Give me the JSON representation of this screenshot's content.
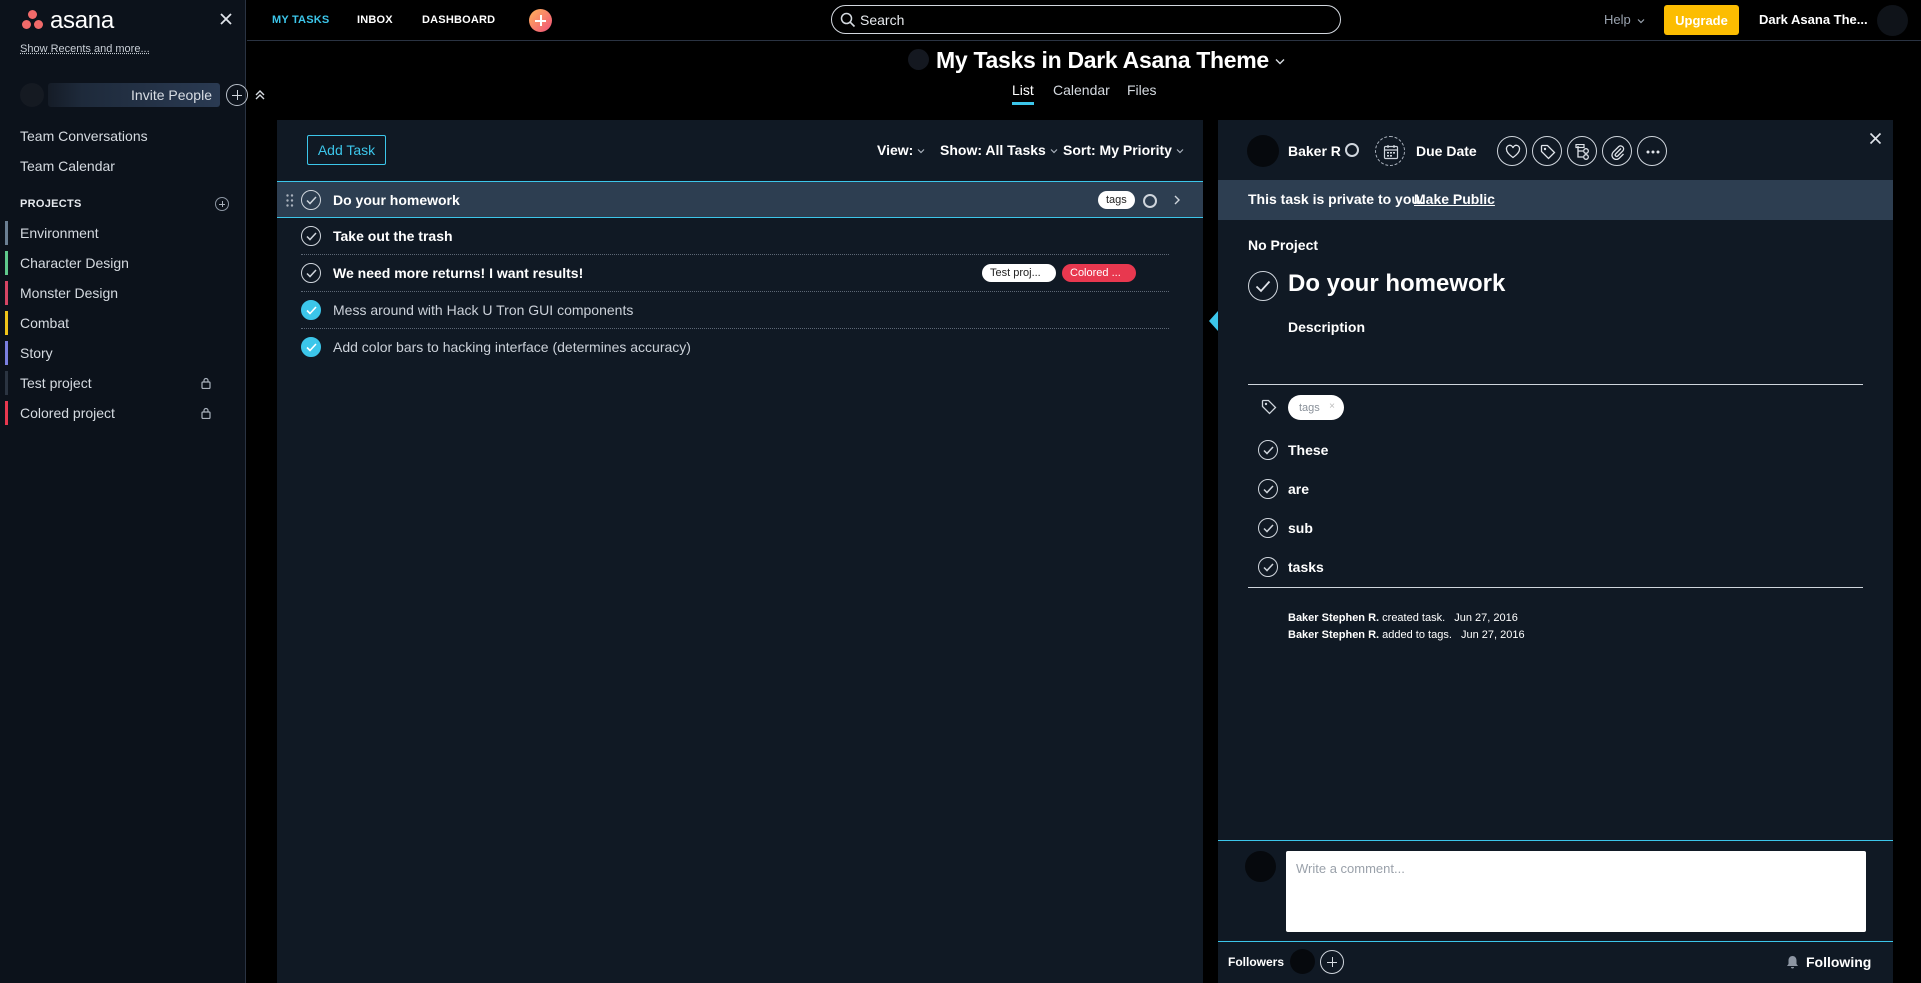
{
  "app": {
    "logo_text": "asana",
    "brand_color": "#f06a6a",
    "accent_color": "#3cc6ea"
  },
  "sidebar": {
    "recents_link": "Show Recents and more...",
    "invite_label": "Invite People",
    "links": [
      "Team Conversations",
      "Team Calendar"
    ],
    "projects_heading": "PROJECTS",
    "projects": [
      {
        "name": "Environment",
        "color": "#6b7f93",
        "locked": false
      },
      {
        "name": "Character Design",
        "color": "#5fc98c",
        "locked": false
      },
      {
        "name": "Monster Design",
        "color": "#d64564",
        "locked": false
      },
      {
        "name": "Combat",
        "color": "#f0c419",
        "locked": false
      },
      {
        "name": "Story",
        "color": "#7a7fe0",
        "locked": false
      },
      {
        "name": "Test project",
        "color": "#2b3441",
        "locked": true
      },
      {
        "name": "Colored project",
        "color": "#e8384f",
        "locked": true
      }
    ]
  },
  "topbar": {
    "nav": [
      {
        "label": "MY TASKS",
        "active": true
      },
      {
        "label": "INBOX",
        "active": false
      },
      {
        "label": "DASHBOARD",
        "active": false
      }
    ],
    "search_placeholder": "Search",
    "help_label": "Help",
    "upgrade_label": "Upgrade",
    "upgrade_color": "#fcbd01",
    "workspace_label": "Dark Asana The..."
  },
  "page": {
    "title": "My Tasks in Dark Asana Theme",
    "view_tabs": [
      {
        "label": "List",
        "active": true
      },
      {
        "label": "Calendar",
        "active": false
      },
      {
        "label": "Files",
        "active": false
      }
    ]
  },
  "task_list": {
    "add_task_label": "Add Task",
    "view_filter": "View:",
    "show_filter": "Show: All Tasks",
    "sort_filter": "Sort: My Priority",
    "tasks": [
      {
        "name": "Do your homework",
        "completed": false,
        "selected": true,
        "tags": [
          "tags"
        ]
      },
      {
        "name": "Take out the trash",
        "completed": false,
        "selected": false,
        "tags": []
      },
      {
        "name": "We need more returns! I want results!",
        "completed": false,
        "selected": false,
        "tags": [
          "Test proj...",
          "Colored ..."
        ]
      },
      {
        "name": "Mess around with Hack U Tron GUI components",
        "completed": true,
        "selected": false,
        "tags": []
      },
      {
        "name": "Add color bars to hacking interface (determines accuracy)",
        "completed": true,
        "selected": false,
        "tags": []
      }
    ]
  },
  "detail": {
    "assignee": "Baker R",
    "due_date_label": "Due Date",
    "private_notice": "This task is private to you.",
    "make_public_label": "Make Public",
    "project_label": "No Project",
    "task_title": "Do your homework",
    "description_label": "Description",
    "tag": "tags",
    "subtasks": [
      "These",
      "are",
      "sub",
      "tasks"
    ],
    "stories": [
      {
        "actor": "Baker Stephen R.",
        "action": "created task.",
        "date": "Jun 27, 2016"
      },
      {
        "actor": "Baker Stephen R.",
        "action": "added to tags.",
        "date": "Jun 27, 2016"
      }
    ],
    "comment_placeholder": "Write a comment...",
    "followers_label": "Followers",
    "following_label": "Following"
  }
}
